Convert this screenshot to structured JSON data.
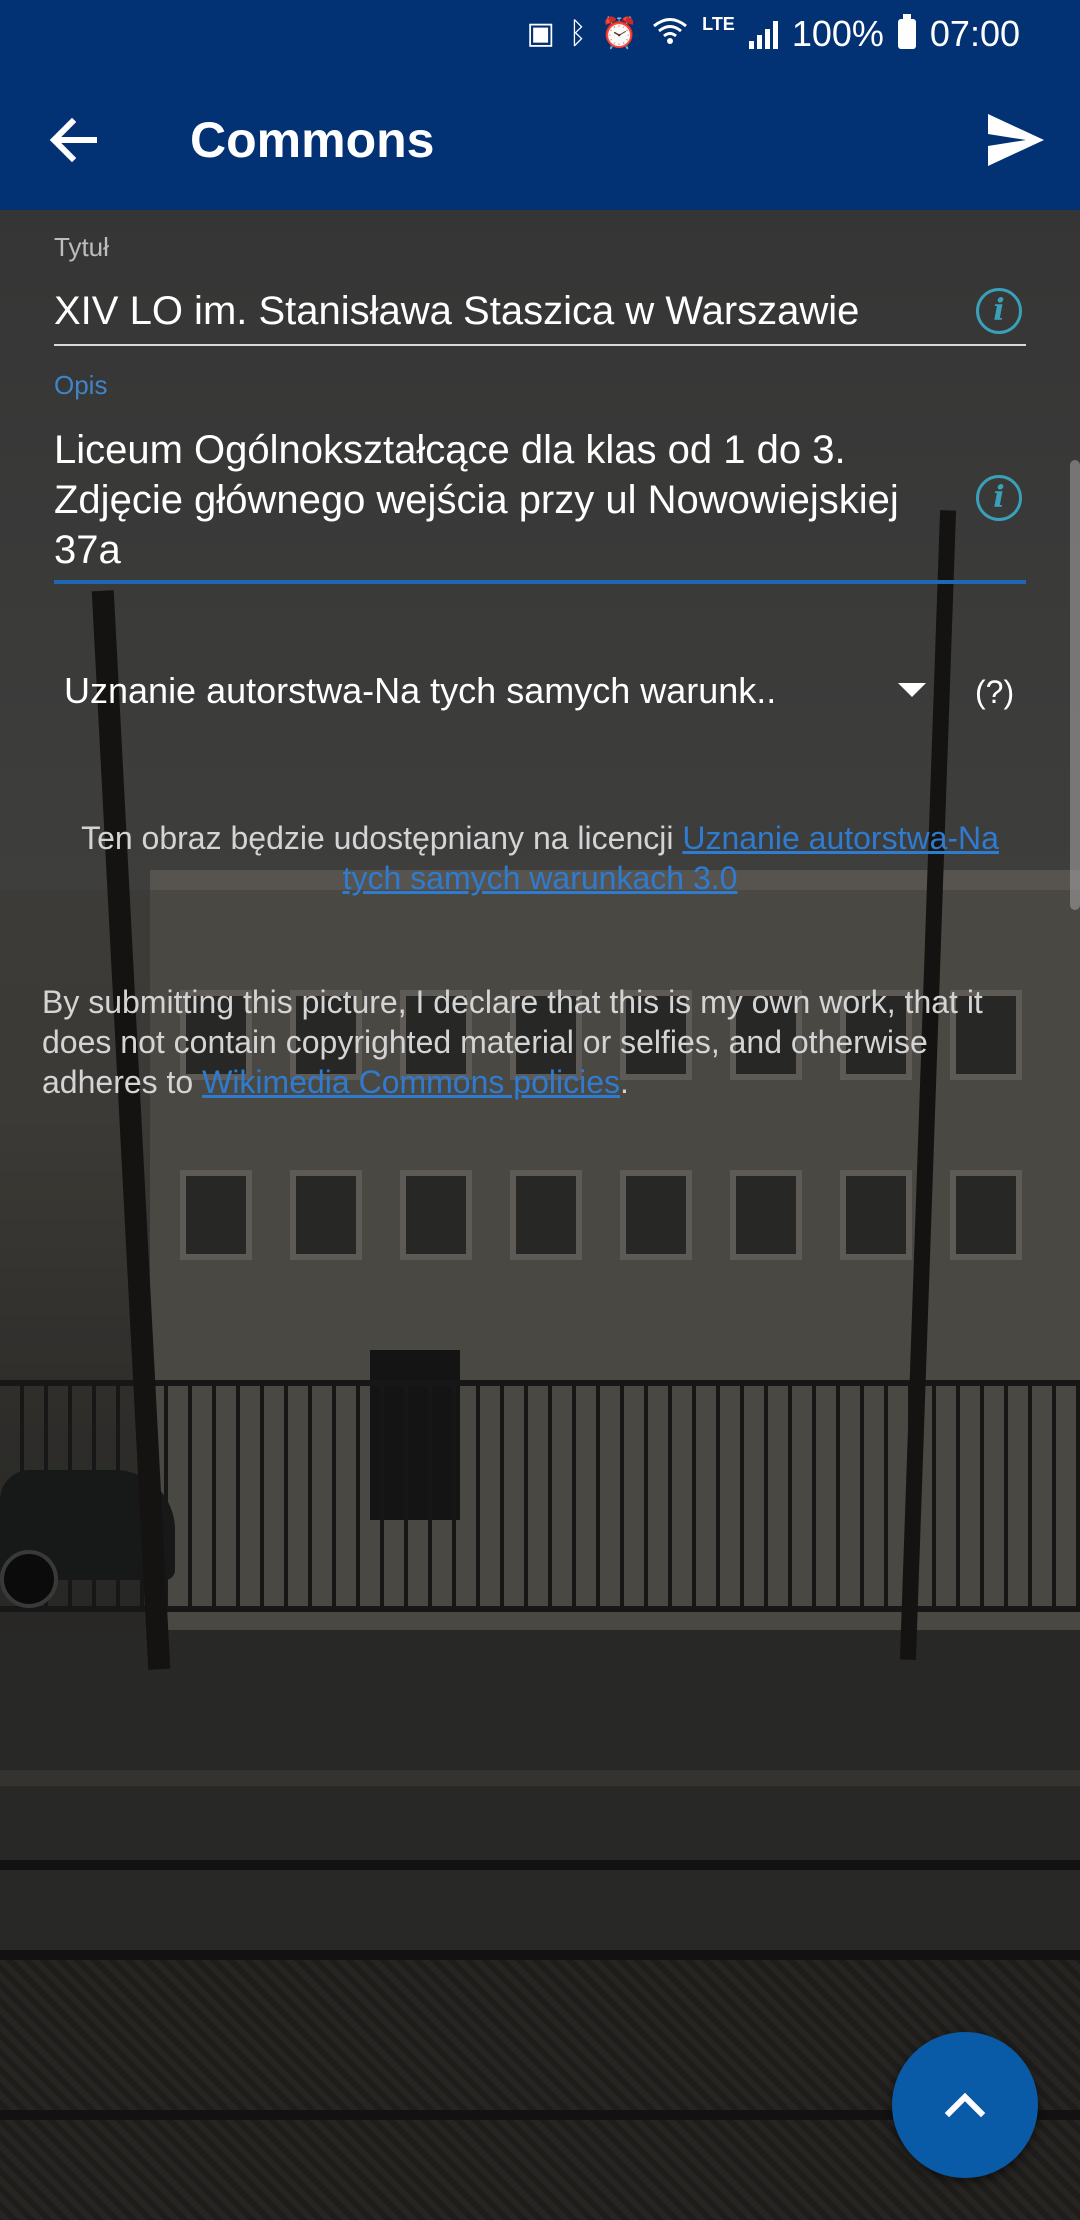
{
  "status_bar": {
    "battery_percent": "100%",
    "time": "07:00",
    "network_label": "LTE",
    "icons": [
      "storage-icon",
      "bluetooth-icon",
      "alarm-icon",
      "wifi-icon",
      "signal-icon",
      "battery-icon"
    ]
  },
  "app_bar": {
    "title": "Commons",
    "back_icon": "arrow-left-icon",
    "send_icon": "send-icon",
    "background": "#033274"
  },
  "form": {
    "title_label": "Tytuł",
    "title_value": "XIV LO im. Stanisława Staszica w Warszawie",
    "description_label": "Opis",
    "description_value": "Liceum Ogólnokształcące dla klas od 1 do 3.\nZdjęcie głównego wejścia przy ul Nowowiejskiej\n37a",
    "license_selected": "Uznanie autorstwa-Na tych samych warunk..",
    "license_help": "(?)"
  },
  "license_info": {
    "prefix": "Ten obraz będzie udostępniany na licencji ",
    "link_text": "Uznanie autorstwa-Na tych samych warunkach 3.0"
  },
  "declaration": {
    "text": "By submitting this picture, I declare that this is my own work, that it does not contain copyrighted material or selfies, and otherwise adheres to ",
    "link_text": "Wikimedia Commons policies",
    "suffix": "."
  },
  "fab": {
    "icon": "chevron-up-icon",
    "color": "#0a5ba7"
  },
  "accent_colors": {
    "link": "#2f7bd0",
    "info_icon": "#3aa0b9",
    "focus_underline": "#1f66b3"
  }
}
